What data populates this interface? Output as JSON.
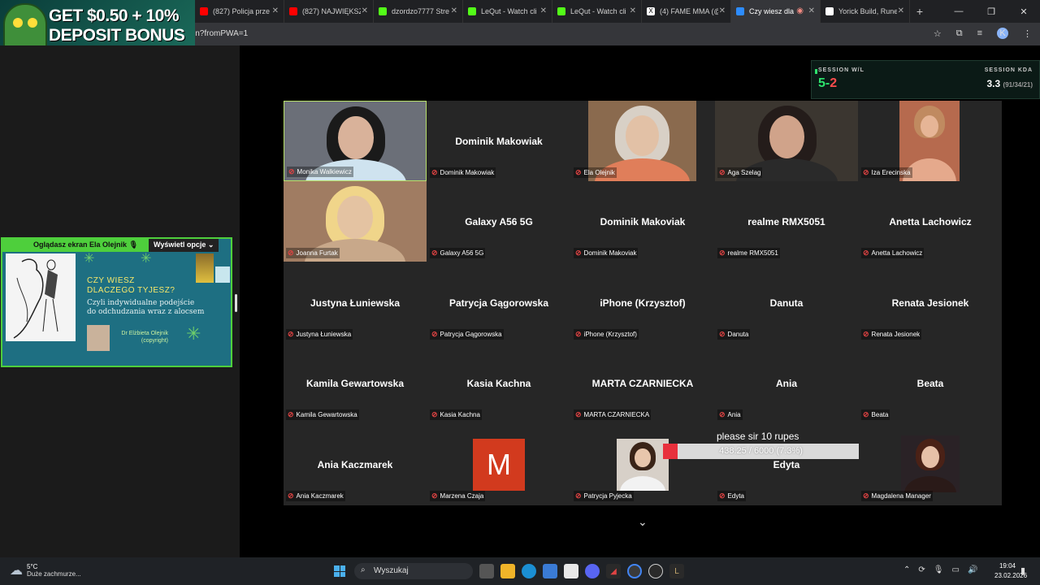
{
  "browser": {
    "tabs": [
      {
        "label": "(827) Policja prze",
        "color": "#ff0000"
      },
      {
        "label": "(827) NAJWIĘKSZ",
        "color": "#ff0000"
      },
      {
        "label": "dzordzo7777 Stre",
        "color": "#53fc18"
      },
      {
        "label": "LeQut - Watch cli",
        "color": "#53fc18"
      },
      {
        "label": "LeQut - Watch cli",
        "color": "#53fc18"
      },
      {
        "label": "(4) FAME MMA (@",
        "color": "#ffffff"
      },
      {
        "label": "Czy wiesz dla",
        "color": "#2d8cff"
      },
      {
        "label": "Yorick Build, Rune",
        "color": "#ffffff"
      }
    ],
    "url": "in?fromPWA=1"
  },
  "ad": {
    "line1": "GET $0.50 + 10%",
    "line2": "DEPOSIT BONUS"
  },
  "share": {
    "title": "Oglądasz ekran  Ela Olejnik",
    "options": "Wyświetl opcje",
    "slide_heading_1": "CZY WIESZ",
    "slide_heading_2": "DLACZEGO TYJESZ?",
    "slide_sub_1": "Czyli indywidualne podejście",
    "slide_sub_2": "do odchudzania wraz z alocsem",
    "slide_author_1": "Dr Elżbieta Olejnik",
    "slide_author_2": "(copyright)"
  },
  "stats": {
    "wl_label": "SESSION W/L",
    "wins": "5",
    "losses": "2",
    "kda_label": "SESSION KDA",
    "kda": "3.3",
    "kda_detail": "(91/34/21)"
  },
  "participants": [
    {
      "name": "Monika Walkiewicz",
      "center": "",
      "video": true
    },
    {
      "name": "Dominik Makowiak",
      "center": "Dominik Makowiak",
      "video": false
    },
    {
      "name": "Ela Olejnik",
      "center": "",
      "video": true
    },
    {
      "name": "Aga Szelag",
      "center": "",
      "video": true
    },
    {
      "name": "Iza Erecinska",
      "center": "",
      "video": true
    },
    {
      "name": "Joanna Furtak",
      "center": "",
      "video": true
    },
    {
      "name": "Galaxy A56 5G",
      "center": "Galaxy A56 5G",
      "video": false
    },
    {
      "name": "Dominik Makoviak",
      "center": "Dominik Makoviak",
      "video": false
    },
    {
      "name": "realme RMX5051",
      "center": "realme RMX5051",
      "video": false
    },
    {
      "name": "Anetta Lachowicz",
      "center": "Anetta Lachowicz",
      "video": false
    },
    {
      "name": "Justyna Łuniewska",
      "center": "Justyna Łuniewska",
      "video": false
    },
    {
      "name": "Patrycja Gągorowska",
      "center": "Patrycja Gągorowska",
      "video": false
    },
    {
      "name": "iPhone (Krzysztof)",
      "center": "iPhone (Krzysztof)",
      "video": false
    },
    {
      "name": "Danuta",
      "center": "Danuta",
      "video": false
    },
    {
      "name": "Renata Jesionek",
      "center": "Renata Jesionek",
      "video": false
    },
    {
      "name": "Kamila Gewartowska",
      "center": "Kamila Gewartowska",
      "video": false
    },
    {
      "name": "Kasia Kachna",
      "center": "Kasia Kachna",
      "video": false
    },
    {
      "name": "MARTA CZARNIECKA",
      "center": "MARTA CZARNIECKA",
      "video": false
    },
    {
      "name": "Ania",
      "center": "Ania",
      "video": false
    },
    {
      "name": "Beata",
      "center": "Beata",
      "video": false
    },
    {
      "name": "Ania Kaczmarek",
      "center": "Ania Kaczmarek",
      "video": false
    },
    {
      "name": "Marzena Czaja",
      "center": "",
      "video": false,
      "avatar": "M"
    },
    {
      "name": "Patrycja Pyjecka",
      "center": "",
      "video": true
    },
    {
      "name": "Edyta",
      "center": "Edyta",
      "video": false
    },
    {
      "name": "Magdalena Manager",
      "center": "",
      "video": true
    }
  ],
  "donation": {
    "title": "please sir 10 rupes",
    "progress_text": "438.25 / 6000 (7.3%)",
    "fraction": 0.073
  },
  "taskbar": {
    "temp": "5°C",
    "weather": "Duże zachmurze...",
    "search": "Wyszukaj",
    "time": "19:04",
    "date": "23.02.2026"
  }
}
